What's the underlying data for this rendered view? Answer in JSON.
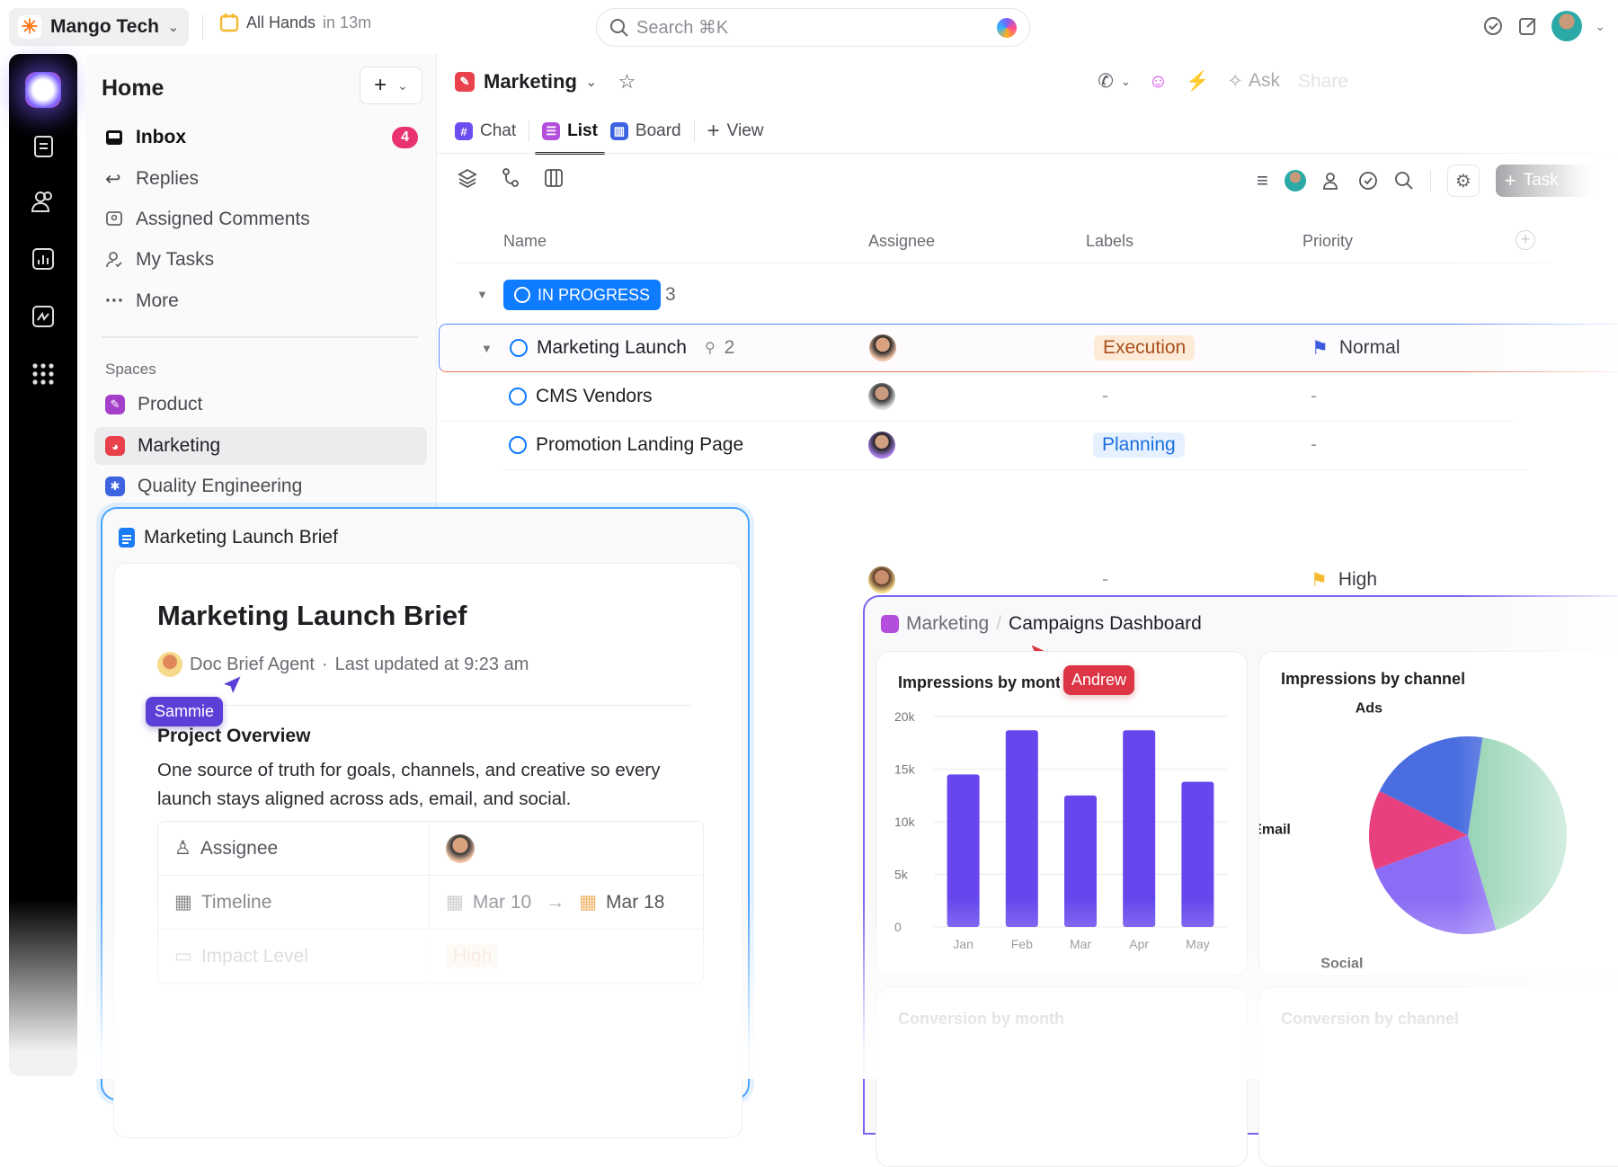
{
  "topbar": {
    "workspace": "Mango Tech",
    "meeting": "All Hands",
    "meeting_time": "in 13m",
    "search_placeholder": "Search ⌘K"
  },
  "sidebar": {
    "title": "Home",
    "items": [
      {
        "label": "Inbox",
        "badge": "4"
      },
      {
        "label": "Replies"
      },
      {
        "label": "Assigned Comments"
      },
      {
        "label": "My Tasks"
      },
      {
        "label": "More"
      }
    ],
    "spaces_label": "Spaces",
    "spaces": [
      {
        "label": "Product",
        "color": "#a43fc9"
      },
      {
        "label": "Marketing",
        "color": "#e8414b"
      },
      {
        "label": "Quality Engineering",
        "color": "#3d63e0"
      }
    ]
  },
  "main": {
    "title": "Marketing",
    "ask_label": "Ask",
    "share_label": "Share",
    "task_button": "Task",
    "tabs": [
      {
        "label": "Chat"
      },
      {
        "label": "List"
      },
      {
        "label": "Board"
      },
      {
        "label": "View"
      }
    ],
    "columns": [
      "Name",
      "Assignee",
      "Labels",
      "Priority"
    ],
    "group": {
      "label": "IN PROGRESS",
      "count": "3"
    },
    "rows": [
      {
        "name": "Marketing Launch",
        "subtasks": "2",
        "label": "Execution",
        "priority": "Normal"
      },
      {
        "name": "CMS Vendors",
        "label": "-",
        "priority": "-"
      },
      {
        "name": "Promotion Landing Page",
        "label": "Planning",
        "priority": "-"
      },
      {
        "label": "-",
        "priority": "High"
      }
    ]
  },
  "brief": {
    "window_title": "Marketing Launch Brief",
    "title": "Marketing Launch Brief",
    "author": "Doc Brief Agent",
    "updated": "Last updated at 9:23 am",
    "cursor_user": "Sammie",
    "section": "Project Overview",
    "paragraph": "One source of truth for goals, channels, and creative so every launch stays aligned across ads, email, and social.",
    "fields": [
      {
        "label": "Assignee"
      },
      {
        "label": "Timeline",
        "start": "Mar 10",
        "end": "Mar 18"
      },
      {
        "label": "Impact Level",
        "value": "High"
      }
    ]
  },
  "dashboard": {
    "breadcrumb_parent": "Marketing",
    "title": "Campaigns Dashboard",
    "cursor_user": "Andrew",
    "card3": "Conversion by month",
    "card4": "Conversion by channel"
  },
  "chart_data": [
    {
      "type": "bar",
      "title": "Impressions by month",
      "categories": [
        "Jan",
        "Feb",
        "Mar",
        "Apr",
        "May"
      ],
      "values": [
        14500,
        18700,
        12500,
        18700,
        13800
      ],
      "ylim": [
        0,
        20000
      ],
      "yticks": [
        "0",
        "5k",
        "10k",
        "15k",
        "20k"
      ],
      "color": "#6747ed",
      "grid": true
    },
    {
      "type": "pie",
      "title": "Impressions by channel",
      "slices": [
        {
          "name": "",
          "value": 43,
          "color": "#8fd1b0"
        },
        {
          "name": "Social",
          "value": 24,
          "color": "#8b6cf5"
        },
        {
          "name": "Email",
          "value": 13,
          "color": "#e8407e"
        },
        {
          "name": "Ads",
          "value": 20,
          "color": "#4a6ee0"
        }
      ]
    }
  ]
}
